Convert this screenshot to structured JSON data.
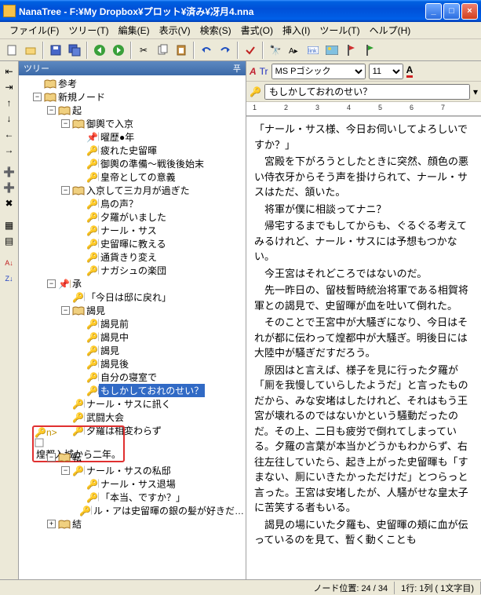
{
  "window": {
    "title": "NanaTree - F:¥My Dropbox¥プロット¥済み¥冴月4.nna",
    "min": "_",
    "max": "□",
    "close": "×"
  },
  "menu": [
    "ファイル(F)",
    "ツリー(T)",
    "編集(E)",
    "表示(V)",
    "検索(S)",
    "書式(O)",
    "挿入(I)",
    "ツール(T)",
    "ヘルプ(H)"
  ],
  "treeHeader": "ツリー",
  "treePin": "푸",
  "format": {
    "font": "MS Pゴシック",
    "size": "11"
  },
  "search": {
    "value": "もしかしておれのせい？"
  },
  "ruler": [
    "1",
    "2",
    "3",
    "4",
    "5",
    "6",
    "7"
  ],
  "tree": [
    {
      "d": 0,
      "exp": "",
      "icon": "book",
      "label": "参考"
    },
    {
      "d": 0,
      "exp": "-",
      "icon": "book",
      "label": "新規ノード"
    },
    {
      "d": 1,
      "exp": "-",
      "icon": "book",
      "label": "起"
    },
    {
      "d": 2,
      "exp": "-",
      "icon": "book",
      "label": "御輿で入京"
    },
    {
      "d": 3,
      "exp": "",
      "icon": "pin",
      "label": "曜歴●年"
    },
    {
      "d": 3,
      "exp": "",
      "icon": "key",
      "label": "疲れた史留暉"
    },
    {
      "d": 3,
      "exp": "",
      "icon": "key",
      "label": "御輿の準備～戦後後始末"
    },
    {
      "d": 3,
      "exp": "",
      "icon": "key",
      "label": "皇帝としての意義"
    },
    {
      "d": 2,
      "exp": "-",
      "icon": "book",
      "label": "入京して三カ月が過ぎた"
    },
    {
      "d": 3,
      "exp": "",
      "icon": "key",
      "label": "鳥の声？"
    },
    {
      "d": 3,
      "exp": "",
      "icon": "key",
      "label": "夕羅がいました"
    },
    {
      "d": 3,
      "exp": "",
      "icon": "key",
      "label": "ナール・サス"
    },
    {
      "d": 3,
      "exp": "",
      "icon": "key",
      "label": "史留暉に教える"
    },
    {
      "d": 3,
      "exp": "",
      "icon": "key",
      "label": "通貨きり変え"
    },
    {
      "d": 3,
      "exp": "",
      "icon": "key",
      "label": "ナガシュの楽団"
    },
    {
      "d": 1,
      "exp": "-",
      "icon": "pinbook",
      "label": "承"
    },
    {
      "d": 2,
      "exp": "",
      "icon": "key",
      "label": "「今日は邸に戻れ」"
    },
    {
      "d": 2,
      "exp": "-",
      "icon": "book",
      "label": "謁見"
    },
    {
      "d": 3,
      "exp": "",
      "icon": "key",
      "label": "謁見前"
    },
    {
      "d": 3,
      "exp": "",
      "icon": "key",
      "label": "謁見中"
    },
    {
      "d": 3,
      "exp": "",
      "icon": "key",
      "label": "謁見"
    },
    {
      "d": 3,
      "exp": "",
      "icon": "key",
      "label": "謁見後"
    },
    {
      "d": 3,
      "exp": "",
      "icon": "key",
      "label": "自分の寝室で"
    },
    {
      "d": 3,
      "exp": "",
      "icon": "keysel",
      "label": "もしかしておれのせい？",
      "sel": true
    },
    {
      "d": 2,
      "exp": "",
      "icon": "key",
      "label": "ナール・サスに訊く"
    },
    {
      "d": 2,
      "exp": "",
      "icon": "key",
      "label": "武闘大会"
    },
    {
      "d": 2,
      "exp": "",
      "icon": "key",
      "label": "夕羅は相変わらず"
    },
    {
      "d": 2,
      "exp": "",
      "icon": "keyhl",
      "label": "煌都入城から二年。",
      "hl": true
    },
    {
      "d": 1,
      "exp": "-",
      "icon": "book",
      "label": "転"
    },
    {
      "d": 2,
      "exp": "-",
      "icon": "key",
      "label": "ナール・サスの私邸"
    },
    {
      "d": 3,
      "exp": "",
      "icon": "key",
      "label": "ナール・サス退場"
    },
    {
      "d": 3,
      "exp": "",
      "icon": "key",
      "label": "「本当、ですか？」"
    },
    {
      "d": 3,
      "exp": "",
      "icon": "key",
      "label": "ル・アは史留暉の銀の髪が好きだ…"
    },
    {
      "d": 1,
      "exp": "+",
      "icon": "book",
      "label": "結"
    }
  ],
  "body": [
    "「ナール・サス様、今日お伺いしてよろしいですか？」",
    "　宮殿を下がろうとしたときに突然、顔色の悪い侍衣牙からそう声を掛けられて、ナール・サスはただ、頷いた。",
    "　将軍が僕に相談ってナニ？",
    "　帰宅するまでもしてからも、ぐるぐる考えてみるけれど、ナール・サスには予想もつかない。",
    "　今王宮はそれどころではないのだ。",
    "　先一昨日の、留枝暫時統治将軍である相賀将軍との謁見で、史留暉が血を吐いて倒れた。",
    "　そのことで王宮中が大騒ぎになり、今日はそれが都に伝わって煌都中が大騒ぎ。明後日には大陸中が騒ぎだすだろう。",
    "　原因はと言えば、様子を見に行った夕羅が「厠を我慢していらしたようだ」と言ったものだから、みな安堵はしたけれど、それはもう王宮が壊れるのではないかという騒動だったのだ。その上、二日も疲労で倒れてしまっている。夕羅の言葉が本当かどうかもわからず、右往左往していたら、起き上がった史留暉も「すまない、厠にいきたかっただけだ」とつらっと言った。王宮は安堵したが、人騒がせな皇太子に苦笑する者もいる。",
    "　謁見の場にいた夕羅も、史留暉の頬に血が伝っているのを見て、暫く動くことも"
  ],
  "status": {
    "nodepos": "ノード位置:  24 /  34",
    "cursor": "1行:   1列 (   1文字目)"
  }
}
